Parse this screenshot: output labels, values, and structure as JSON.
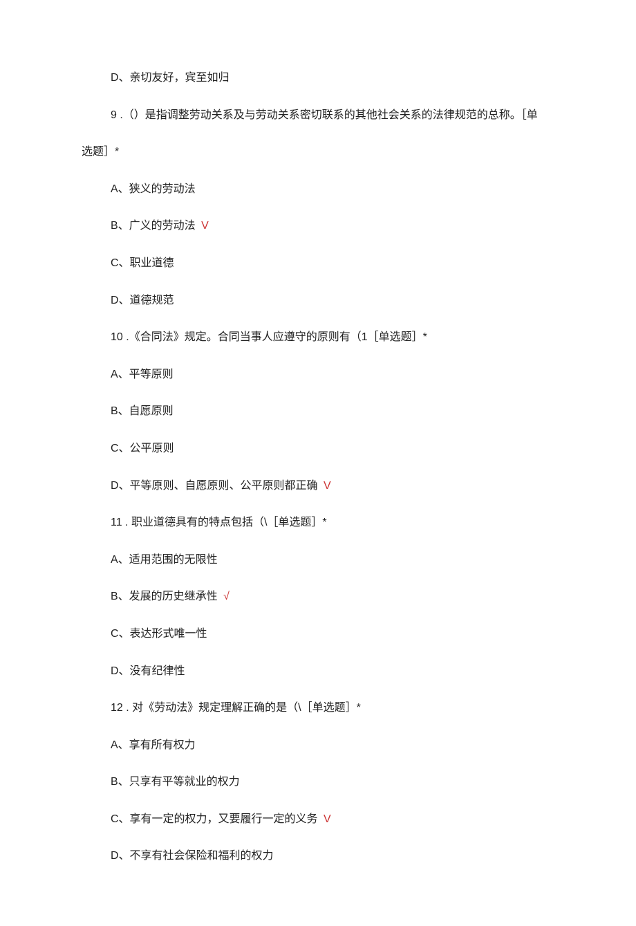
{
  "q8": {
    "option_d": "D、亲切友好，宾至如归"
  },
  "q9": {
    "stem_prefix": "9 .（）是指调整劳动关系及与劳动关系密切联系的其他社会关系的法律规范的总称。［单",
    "stem_suffix_wrap": "选题］*",
    "option_a": "A、狭义的劳动法",
    "option_b": "B、广义的劳动法",
    "option_c": "C、职业道德",
    "option_d": "D、道德规范",
    "correct_mark": "V"
  },
  "q10": {
    "stem": "10 .《合同法》规定。合同当事人应遵守的原则有（1［单选题］*",
    "option_a": "A、平等原则",
    "option_b": "B、自愿原则",
    "option_c": "C、公平原则",
    "option_d": "D、平等原则、自愿原则、公平原则都正确",
    "correct_mark": "V"
  },
  "q11": {
    "stem": "11 . 职业道德具有的特点包括（\\［单选题］*",
    "option_a": "A、适用范围的无限性",
    "option_b": "B、发展的历史继承性",
    "option_c": "C、表达形式唯一性",
    "option_d": "D、没有纪律性",
    "correct_mark": "√"
  },
  "q12": {
    "stem": "12 . 对《劳动法》规定理解正确的是（\\［单选题］*",
    "option_a": "A、享有所有权力",
    "option_b": "B、只享有平等就业的权力",
    "option_c": "C、享有一定的权力，又要履行一定的义务",
    "option_d": "D、不享有社会保险和福利的权力",
    "correct_mark": "V"
  }
}
